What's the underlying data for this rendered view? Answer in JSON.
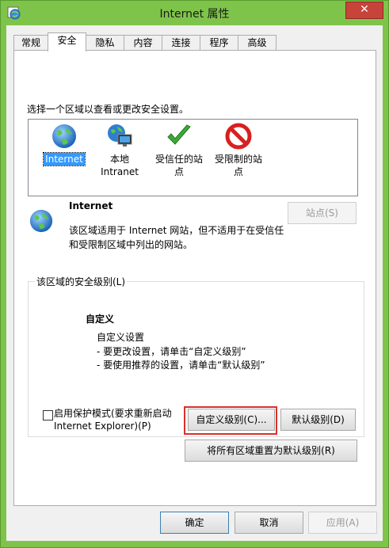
{
  "window": {
    "title": "Internet 属性",
    "close_glyph": "✕"
  },
  "tabs": [
    "常规",
    "安全",
    "隐私",
    "内容",
    "连接",
    "程序",
    "高级"
  ],
  "active_tab": "安全",
  "security": {
    "prompt": "选择一个区域以查看或更改安全设置。",
    "zones": [
      {
        "line1": "Internet",
        "line2": "",
        "icon": "globe-icon",
        "selected": true
      },
      {
        "line1": "本地",
        "line2": "Intranet",
        "icon": "intranet-icon",
        "selected": false
      },
      {
        "line1": "受信任的站",
        "line2": "点",
        "icon": "checkmark-icon",
        "selected": false
      },
      {
        "line1": "受限制的站",
        "line2": "点",
        "icon": "prohibited-icon",
        "selected": false
      }
    ],
    "zone_title": "Internet",
    "zone_desc_line1": "该区域适用于 Internet 网站，但不适用于在受信任",
    "zone_desc_line2": "和受限制区域中列出的网站。",
    "sites_button": "站点(S)",
    "level_group_title": "该区域的安全级别(L)",
    "level_name": "自定义",
    "level_line1": "自定义设置",
    "level_line2": "- 要更改设置，请单击“自定义级别”",
    "level_line3": "- 要使用推荐的设置，请单击“默认级别”",
    "protected_mode_line1": "启用保护模式(要求重新启动",
    "protected_mode_line2": "Internet Explorer)(P)",
    "protected_mode_checked": false,
    "custom_level_button": "自定义级别(C)...",
    "default_level_button": "默认级别(D)",
    "reset_all_button": "将所有区域重置为默认级别(R)"
  },
  "footer": {
    "ok": "确定",
    "cancel": "取消",
    "apply": "应用(A)"
  },
  "colors": {
    "titlebar": "#7fc44a",
    "close": "#c7443a",
    "selection": "#3399ff",
    "highlight": "#d9312b"
  }
}
